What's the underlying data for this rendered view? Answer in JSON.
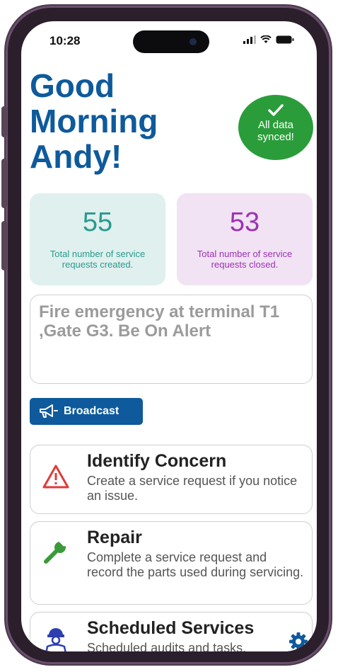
{
  "status_bar": {
    "time": "10:28"
  },
  "greeting": "Good\nMorning\nAndy!",
  "sync_badge": {
    "label": "All data synced!"
  },
  "stats": {
    "created": {
      "value": "55",
      "label": "Total number of service requests created."
    },
    "closed": {
      "value": "53",
      "label": "Total number of service requests closed."
    }
  },
  "alert_message": "Fire emergency at terminal T1 ,Gate G3. Be On Alert",
  "broadcast_button": "Broadcast",
  "actions": [
    {
      "title": "Identify Concern",
      "description": "Create a service request if you notice an issue.",
      "icon": "warning-icon"
    },
    {
      "title": "Repair",
      "description": "Complete a service request and record the parts used during servicing.",
      "icon": "wrench-icon"
    },
    {
      "title": "Scheduled Services",
      "description": "Scheduled audits and tasks.",
      "icon": "worker-icon"
    }
  ],
  "colors": {
    "brand_blue": "#0e5a9c",
    "sync_green": "#2a9d3a",
    "created_teal": "#2a9a8e",
    "closed_purple": "#9c32b3",
    "warning_red": "#e03a3a",
    "wrench_green": "#3a9a3a"
  }
}
